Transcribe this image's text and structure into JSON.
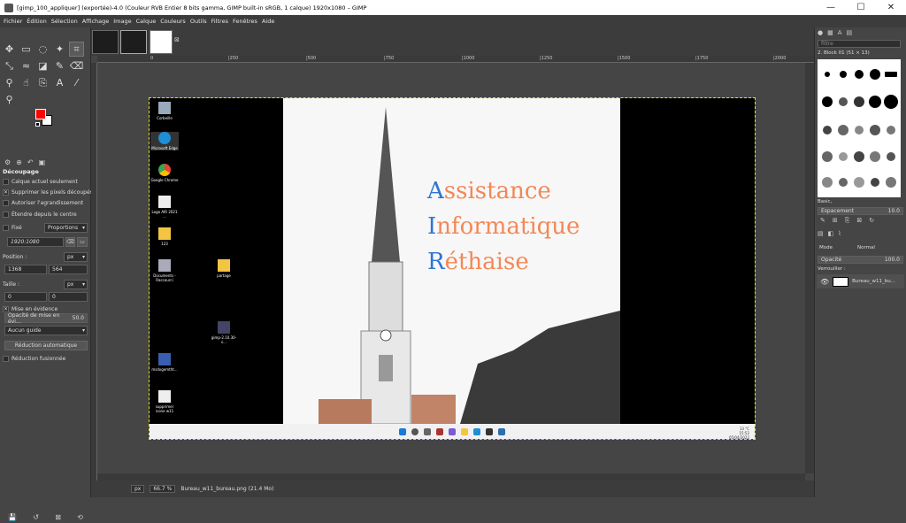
{
  "window": {
    "title": "[gimp_100_appliquer] (exportée)-4.0 (Couleur RVB Entier 8 bits gamma, GIMP built-in sRGB, 1 calque) 1920x1080 – GIMP",
    "minimize": "—",
    "maximize": "☐",
    "close": "✕"
  },
  "menu": [
    "Fichier",
    "Édition",
    "Sélection",
    "Affichage",
    "Image",
    "Calque",
    "Couleurs",
    "Outils",
    "Filtres",
    "Fenêtres",
    "Aide"
  ],
  "colors": {
    "foreground": "#ff0000",
    "background": "#ffffff",
    "accent_blue": "#2f74d6",
    "accent_orange": "#f48757"
  },
  "tool_options": {
    "title": "Découpage",
    "current_layer_only": "Calque actuel seulement",
    "delete_cropped": "Supprimer les pixels découpés",
    "allow_grow": "Autoriser l'agrandissement",
    "expand_center": "Étendre depuis le centre",
    "fixed_label": "Fixé",
    "fixed_mode": "Proportions",
    "ratio": "1920:1080",
    "position_label": "Position :",
    "position_unit": "px",
    "pos_x": "1368",
    "pos_y": "564",
    "size_label": "Taille :",
    "size_unit": "px",
    "size_w": "0",
    "size_h": "0",
    "highlight": "Mise en évidence",
    "highlight_opacity_label": "Opacité de mise en évi…",
    "highlight_opacity": "50.0",
    "guides": "Aucun guide",
    "auto_shrink": "Réduction automatique",
    "shrink_merged": "Réduction fusionnée"
  },
  "ruler": {
    "ticks": [
      "0",
      "|250",
      "|500",
      "|750",
      "|1000",
      "|1250",
      "|1500",
      "|1750",
      "|2000"
    ]
  },
  "desktop_icons": [
    "Corbeille",
    "Microsoft Edge",
    "Google Chrome",
    "Logo AIR 2021 ...",
    "123",
    "Documents - Raccourci",
    "partage",
    "gimp-2.10.30-s...",
    "msdxgemtht...",
    "supprimer icone w11"
  ],
  "wallpaper": {
    "line1_cap": "A",
    "line1_rest": "ssistance",
    "line2_cap": "I",
    "line2_rest": "nformatique",
    "line3_cap": "R",
    "line3_rest": "éthaise"
  },
  "taskbar": {
    "tray": "13 °C",
    "time": "15:52",
    "date": "05/04/2022"
  },
  "status": {
    "unit": "px",
    "zoom": "66.7 %",
    "file": "Bureau_w11_bureau.png (21.4 Mo)"
  },
  "right_panel": {
    "filter_placeholder": "filtre",
    "brush_name": "2. Block 01 (51 × 13)",
    "brush_tag": "Basic,",
    "spacing_label": "Espacement",
    "spacing_value": "10.0",
    "mode_label": "Mode",
    "mode_value": "Normal",
    "opacity_label": "Opacité",
    "opacity_value": "100.0",
    "lock_label": "Verrouiller :",
    "layer_name": "Bureau_w11_bu..."
  }
}
